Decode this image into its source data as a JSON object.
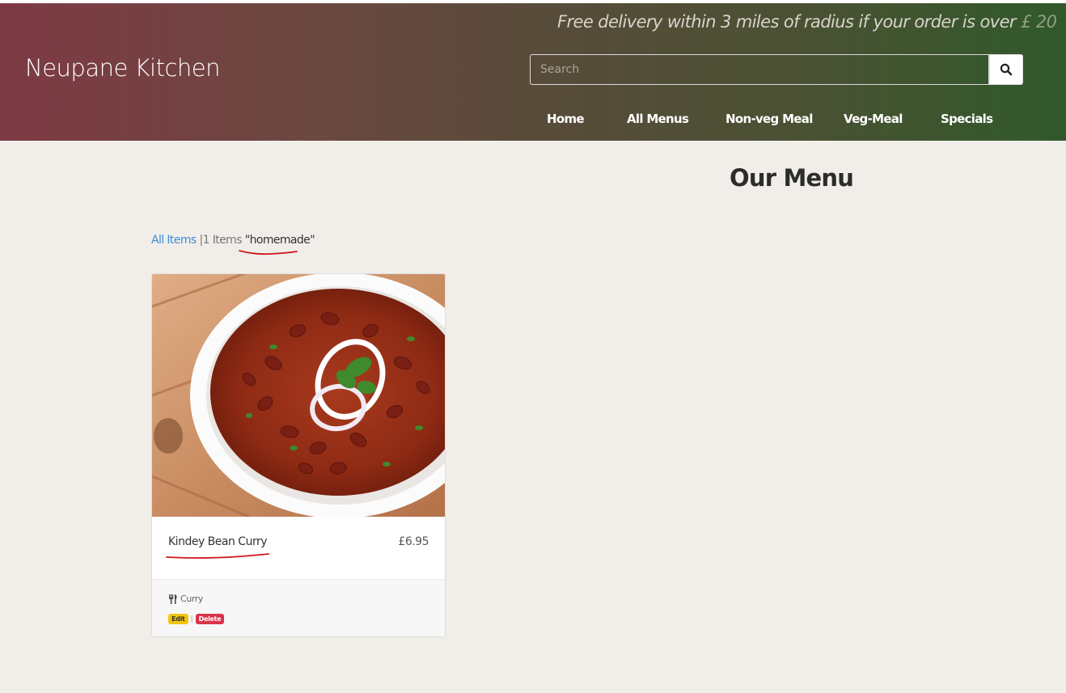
{
  "site": {
    "brand": "Neupane Kitchen",
    "promo_text": "Free delivery within 3 miles of radius if your order is over",
    "promo_amount": "£ 20"
  },
  "search": {
    "placeholder": "Search",
    "value": ""
  },
  "nav": {
    "home": "Home",
    "all_menus": "All Menus",
    "non_veg": "Non-veg Meal",
    "veg": "Veg-Meal",
    "specials": "Specials"
  },
  "main": {
    "title": "Our Menu",
    "breadcrumb": {
      "all_items": "All Items",
      "separator": "|",
      "count": "1 Items",
      "quote_open": "\"",
      "term": "homemade",
      "quote_close": "\""
    },
    "items": [
      {
        "name": "Kindey Bean Curry",
        "price": "£6.95",
        "category": "Curry",
        "edit_label": "Edit",
        "action_separator": "|",
        "delete_label": "Delete",
        "image_icon": "curry-bowl-photo"
      }
    ]
  },
  "colors": {
    "header_left": "#7e3a44",
    "header_right": "#30592a",
    "page_bg": "#f1eeea",
    "link": "#3b8fd6",
    "edit_badge": "#f1c40f",
    "delete_badge": "#d9344a",
    "annotation_red": "#d0161c"
  }
}
